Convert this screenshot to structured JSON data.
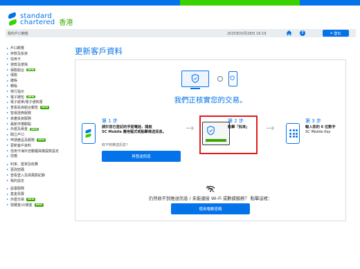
{
  "brand": {
    "line1": "standard",
    "line2": "chartered",
    "region": "香港"
  },
  "statusbar": {
    "account_label": "我的戶口範籃",
    "datetime": "2025年03月28日 16:19",
    "logout_label": "登出"
  },
  "sidebar": {
    "new_badge": "NEW",
    "groups": [
      [
        {
          "label": "戶口概覽",
          "new": false
        },
        {
          "label": "存款及投資",
          "new": false
        },
        {
          "label": "信用卡",
          "new": false
        },
        {
          "label": "貸款及按揭",
          "new": false
        },
        {
          "label": "保險組合",
          "new": true
        },
        {
          "label": "保險",
          "new": false
        },
        {
          "label": "繳賬",
          "new": false
        },
        {
          "label": "轉賬",
          "new": false
        },
        {
          "label": "常行指示",
          "new": false
        },
        {
          "label": "電子錢包",
          "new": true
        },
        {
          "label": "電子結單/電子通知書",
          "new": false
        },
        {
          "label": "查看投資組合報告",
          "new": true
        },
        {
          "label": "智易證券服務",
          "new": false
        },
        {
          "label": "資產投資服務",
          "new": false
        },
        {
          "label": "最新市場觀點",
          "new": false
        },
        {
          "label": "外匯及黃金",
          "new": true
        },
        {
          "label": "開立戶口",
          "new": false
        },
        {
          "label": "申請產品及服務",
          "new": true
        },
        {
          "label": "更新客戶資料",
          "new": false
        },
        {
          "label": "信用卡海外自動櫃員機提款設定",
          "new": false
        },
        {
          "label": "信箱",
          "new": false
        }
      ],
      [
        {
          "label": "利率、匯率及收費",
          "new": false
        },
        {
          "label": "更改密碼",
          "new": false
        },
        {
          "label": "查看登入及高風險紀錄",
          "new": false
        },
        {
          "label": "我的設定",
          "new": false
        }
      ],
      [
        {
          "label": "設置服務",
          "new": false
        },
        {
          "label": "基金買賣",
          "new": false
        },
        {
          "label": "外匯交易",
          "new": true
        },
        {
          "label": "強積金/公積金",
          "new": true
        }
      ]
    ]
  },
  "main": {
    "title": "更新客戶資料",
    "headline": "我們正核實您的交易。",
    "steps": [
      {
        "title": "第 1 步",
        "description_line1": "請於您已登記的手提電話，開啟",
        "description_line2": "SC Mobile 應用程式或點擊推送訊息。",
        "sub": "收不到推送訊息？",
        "button": "再發送訊息"
      },
      {
        "title": "第 2 步",
        "description_line1": "點擊「批准」",
        "description_line2": ""
      },
      {
        "title": "第 3 步",
        "description_line1": "輸入您的 6 位數字",
        "description_line2": "SC Mobile Key"
      }
    ],
    "no_push_text": "仍然收不到推送訊息 / 未能連接 Wi-Fi 或數據服務？ 點擊這裡：",
    "sms_button": "使用電郵密碼"
  },
  "colors": {
    "brand_blue": "#0473ea",
    "brand_green": "#38d200",
    "highlight_red": "#e01b1b"
  }
}
